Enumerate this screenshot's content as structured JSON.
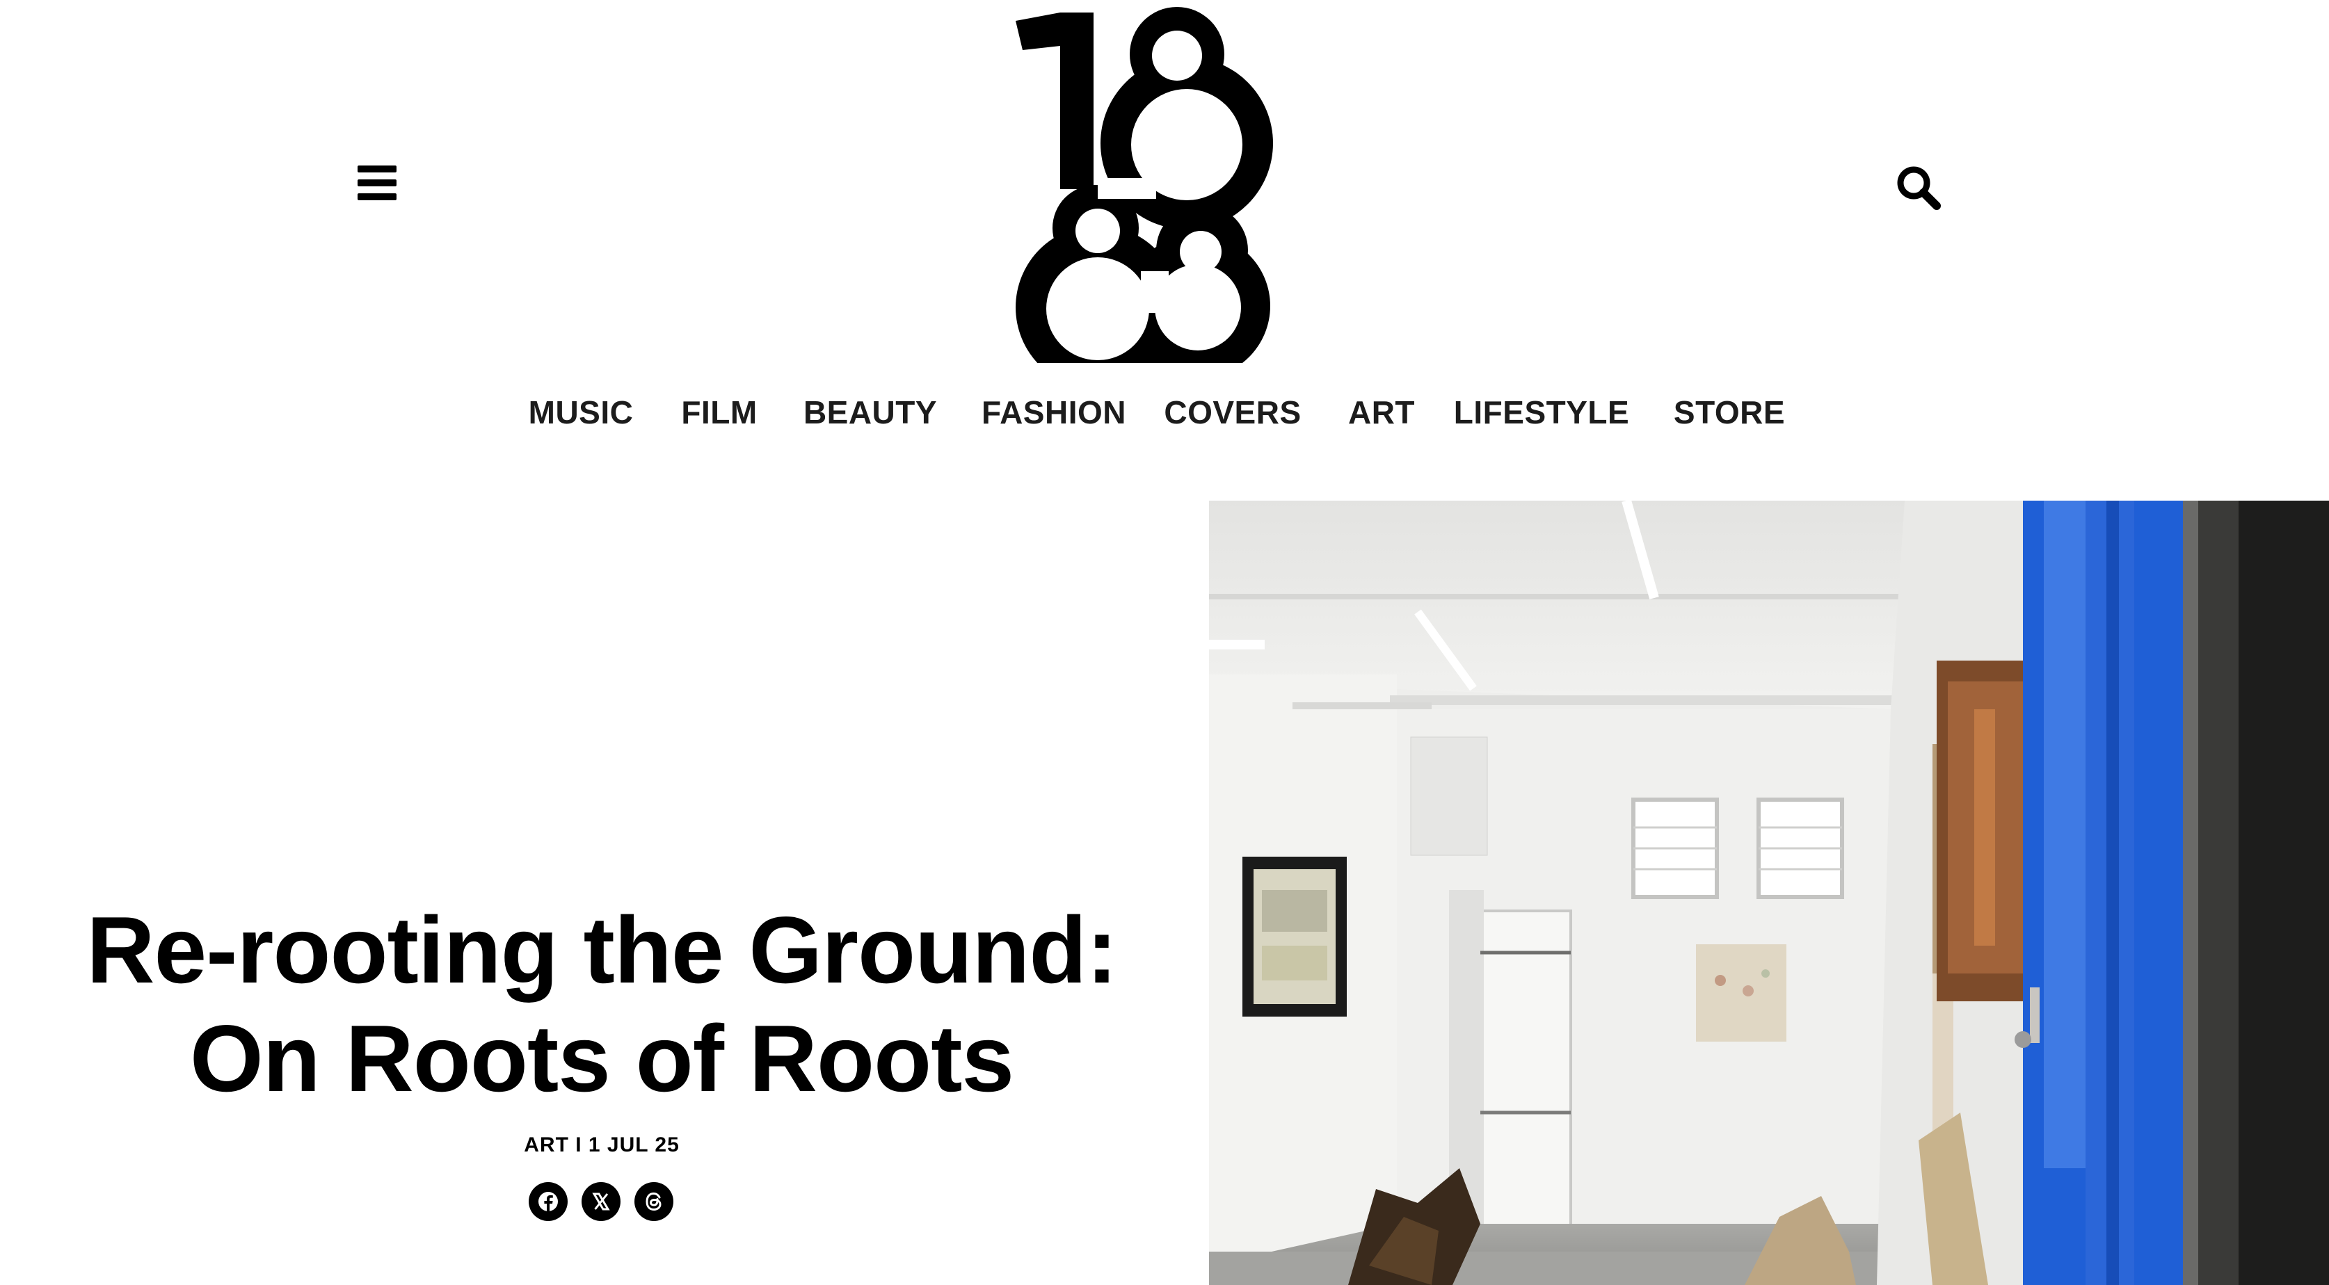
{
  "header": {
    "logo_text": "1883",
    "menu_icon": "hamburger-menu-icon",
    "search_icon": "search-icon"
  },
  "nav": {
    "items": [
      {
        "label": "MUSIC"
      },
      {
        "label": "FILM"
      },
      {
        "label": "BEAUTY"
      },
      {
        "label": "FASHION"
      },
      {
        "label": "COVERS"
      },
      {
        "label": "ART"
      },
      {
        "label": "LIFESTYLE"
      },
      {
        "label": "STORE"
      }
    ]
  },
  "article": {
    "title_line1": "Re-rooting the Ground:",
    "title_line2": "On Roots of Roots",
    "category": "ART",
    "separator": "I",
    "date": "1 JUL 25",
    "meta": "ART I 1 JUL 25"
  },
  "share": {
    "icons": [
      "facebook-icon",
      "x-twitter-icon",
      "threads-icon"
    ]
  },
  "colors": {
    "text": "#000000",
    "nav_text": "#1c1c1c",
    "background": "#ffffff",
    "door_blue": "#1f5fd6"
  }
}
